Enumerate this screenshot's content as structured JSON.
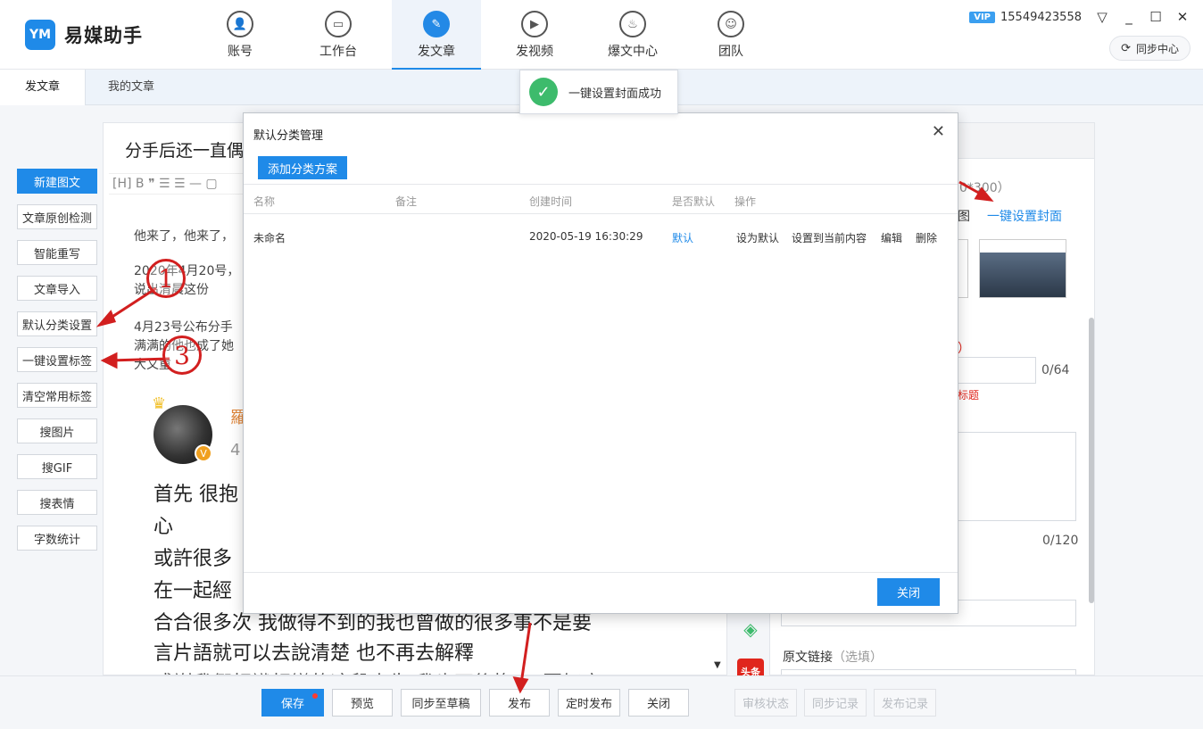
{
  "app": {
    "logo_mark": "YM",
    "name": "易媒助手"
  },
  "nav": [
    {
      "label": "账号",
      "icon": "user-icon"
    },
    {
      "label": "工作台",
      "icon": "monitor-icon"
    },
    {
      "label": "发文章",
      "icon": "feather-icon",
      "active": true
    },
    {
      "label": "发视频",
      "icon": "play-icon"
    },
    {
      "label": "爆文中心",
      "icon": "fire-icon"
    },
    {
      "label": "团队",
      "icon": "team-icon"
    }
  ],
  "user": {
    "vip": "VIP",
    "phone": "15549423558",
    "sync": "同步中心"
  },
  "subtabs": [
    "发文章",
    "我的文章"
  ],
  "toast": "一键设置封面成功",
  "tools": [
    "新建图文",
    "文章原创检测",
    "智能重写",
    "文章导入",
    "默认分类设置",
    "一键设置标签",
    "清空常用标签",
    "搜图片",
    "搜GIF",
    "搜表情",
    "字数统计"
  ],
  "editor": {
    "title": "分手后还一直偶",
    "toolbar": "[H] B ❞ ☰ ☰ — ▢",
    "p1": "他来了，他来了，",
    "p2a": "2020年4月20号，",
    "p2b": "说出清晨这份",
    "p3a": "4月23号公布分手",
    "p3b": "满满的他也成了她",
    "p3c": "大又重",
    "author_initial": "羅",
    "author_meta": "4",
    "big1": "首先 很抱",
    "big2": "心",
    "big3": "或許很多",
    "big4": "在一起經",
    "big5": "合合很多次 我做得不到的我也曾做的很多事不是要",
    "big6": "言片語就可以去說清楚 也不再去解釋",
    "big7": "感謝我們相識相戀的這段人生 我也不後悔 ◎ 回好意"
  },
  "right": {
    "size_hint": "0*300）",
    "cover_tab": "图",
    "one_key_cover": "一键设置封面",
    "title_count": "0/64",
    "title_hint": "标题",
    "required_mark": "）",
    "summary_count": "0/120",
    "source_label": "原文链接",
    "source_optional": "（选填）"
  },
  "platforms": [
    "toutiao-green-icon",
    "toutiao-red-icon"
  ],
  "platform_label": "头条",
  "bottom": {
    "save": "保存",
    "preview": "预览",
    "sync_draft": "同步至草稿",
    "publish": "发布",
    "timed_publish": "定时发布",
    "close": "关闭",
    "review_status": "审核状态",
    "sync_record": "同步记录",
    "publish_record": "发布记录"
  },
  "modal": {
    "title": "默认分类管理",
    "add_button": "添加分类方案",
    "columns": [
      "名称",
      "备注",
      "创建时间",
      "是否默认",
      "操作"
    ],
    "rows": [
      {
        "name": "未命名",
        "note": "",
        "created": "2020-05-19 16:30:29",
        "is_default": "默认",
        "ops": [
          "设为默认",
          "设置到当前内容",
          "编辑",
          "删除"
        ]
      }
    ],
    "close_button": "关闭"
  },
  "annotations": [
    "1",
    "3"
  ],
  "colors": {
    "primary": "#1f8ae8",
    "success": "#3dbb6c",
    "annotation": "#d21f1f"
  }
}
